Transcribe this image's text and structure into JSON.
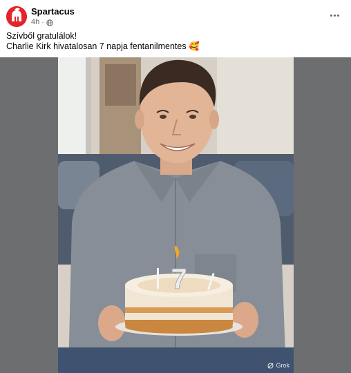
{
  "post": {
    "author": "Spartacus",
    "time": "4h",
    "separator": "·",
    "caption_line1": "Szívből gratulálok!",
    "caption_line2": "Charlie Kirk hivatalosan 7 napja fentanilmentes 🥰",
    "visibility_icon": "globe-icon",
    "menu_icon": "more-options-icon"
  },
  "photo": {
    "cake_number": "7",
    "watermark": "Grok"
  },
  "colors": {
    "avatar_bg": "#e0262b",
    "letterbox": "#6d6e70",
    "shirt": "#8a9099",
    "wall": "#d9d3cb"
  }
}
